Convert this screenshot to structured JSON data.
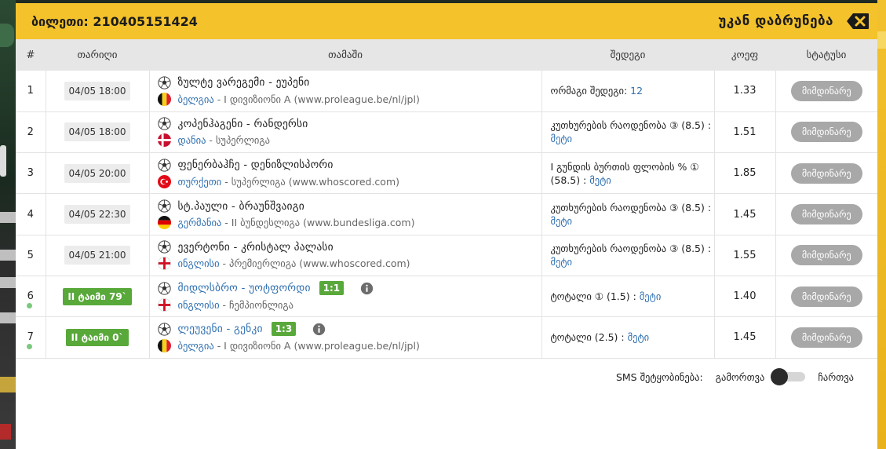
{
  "header": {
    "ticket": "ბილეთი: 210405151424",
    "back_label": "უკან დაბრუნება"
  },
  "columns": [
    "#",
    "თარიღი",
    "თამაში",
    "შედეგი",
    "კოეფ",
    "სტატუსი"
  ],
  "rows": [
    {
      "num": "1",
      "date": "04/05 18:00",
      "live": false,
      "teams": "ზულტე ვარეგემი - ეუპენი",
      "score": "",
      "flag": "belgium-flag-icon",
      "country": "ბელგია",
      "league": " - I დივიზიონი A (www.proleague.be/nl/jpl)",
      "result": "ორმაგი შედეგი: ",
      "pick": "12",
      "odds": "1.33",
      "status": "მიმდინარე"
    },
    {
      "num": "2",
      "date": "04/05 18:00",
      "live": false,
      "teams": "კოპენჰაგენი - რანდერსი",
      "score": "",
      "flag": "denmark-flag-icon",
      "country": "დანია",
      "league": " - სუპერლიგა",
      "result": "კუთხურების რაოდენობა ③ (8.5) : ",
      "pick": "მეტი",
      "odds": "1.51",
      "status": "მიმდინარე"
    },
    {
      "num": "3",
      "date": "04/05 20:00",
      "live": false,
      "teams": "ფენერბაჰჩე - დენიზლისპორი",
      "score": "",
      "flag": "turkey-flag-icon",
      "country": "თურქეთი",
      "league": " - სუპერლიგა (www.whoscored.com)",
      "result": "I გუნდის ბურთის ფლობის % ① (58.5) : ",
      "pick": "მეტი",
      "odds": "1.85",
      "status": "მიმდინარე"
    },
    {
      "num": "4",
      "date": "04/05 22:30",
      "live": false,
      "teams": "სტ.პაული - ბრაუნშვაიგი",
      "score": "",
      "flag": "germany-flag-icon",
      "country": "გერმანია",
      "league": " - II ბუნდესლიგა (www.bundesliga.com)",
      "result": "კუთხურების რაოდენობა ③ (8.5) : ",
      "pick": "მეტი",
      "odds": "1.45",
      "status": "მიმდინარე"
    },
    {
      "num": "5",
      "date": "04/05 21:00",
      "live": false,
      "teams": "ევერტონი - კრისტალ პალასი",
      "score": "",
      "flag": "england-flag-icon",
      "country": "ინგლისი",
      "league": " - პრემიერლიგა (www.whoscored.com)",
      "result": "კუთხურების რაოდენობა ③ (8.5) : ",
      "pick": "მეტი",
      "odds": "1.55",
      "status": "მიმდინარე"
    },
    {
      "num": "6",
      "date": "II ტაიმი 79`",
      "live": true,
      "teams": "მიდლსბრო - უოტფორდი",
      "score": "1:1",
      "flag": "england-flag-icon",
      "country": "ინგლისი",
      "league": " - ჩემპიონლიგა",
      "result": "ტოტალი ① (1.5) : ",
      "pick": "მეტი",
      "odds": "1.40",
      "status": "მიმდინარე"
    },
    {
      "num": "7",
      "date": "II ტაიმი 0`",
      "live": true,
      "teams": "ლეუვენი - გენკი",
      "score": "1:3",
      "flag": "belgium-flag-icon",
      "country": "ბელგია",
      "league": " - I დივიზიონი A (www.proleague.be/nl/jpl)",
      "result": "ტოტალი (2.5) : ",
      "pick": "მეტი",
      "odds": "1.45",
      "status": "მიმდინარე"
    }
  ],
  "sms": {
    "label": "SMS შეტყობინება:",
    "off_label": "გამორთვა",
    "on_label": "ჩართვა",
    "state": "off"
  },
  "colors": {
    "header_bg": "#f4c22b",
    "live_green": "#58a83a",
    "link_blue": "#2f6fb0",
    "status_gray": "#a8a8a8"
  }
}
